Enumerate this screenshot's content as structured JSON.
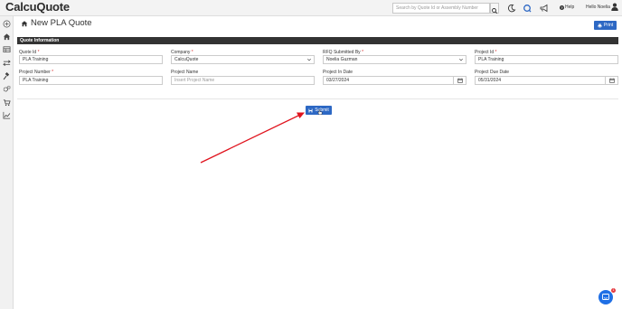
{
  "app": {
    "logo": "CalcuQuote"
  },
  "topbar": {
    "search_placeholder": "Search by Quote Id or Assembly Number",
    "help_label": "Help",
    "greeting": "Hello Noelia"
  },
  "page": {
    "title": "New PLA Quote",
    "print_label": "Print"
  },
  "section": {
    "title": "Quote Information"
  },
  "fields": {
    "quote_id": {
      "label": "Quote Id",
      "required": "*",
      "value": "PLA Training"
    },
    "company": {
      "label": "Company",
      "required": "*",
      "value": "CalcuQuote"
    },
    "rfq_submitted_by": {
      "label": "RFQ Submitted By",
      "required": "*",
      "value": "Noelia Guzman"
    },
    "project_id": {
      "label": "Project Id",
      "required": "*",
      "value": "PLA Training"
    },
    "project_number": {
      "label": "Project Number",
      "required": "*",
      "value": "PLA Training"
    },
    "project_name": {
      "label": "Project Name",
      "placeholder": "Insert Project Name"
    },
    "project_in_date": {
      "label": "Project In Date",
      "value": "03/27/2024"
    },
    "project_due_date": {
      "label": "Project Due Date",
      "value": "05/31/2024"
    }
  },
  "actions": {
    "submit_label": "Submit"
  },
  "chat": {
    "badge_count": "1"
  },
  "colors": {
    "primary": "#2d68c4",
    "section_bar": "#333333",
    "annotation_arrow": "#e0141e",
    "chat": "#1f6fe5"
  },
  "icons": {
    "sidebar": [
      "plus-circle-icon",
      "home-icon",
      "table-icon",
      "exchange-icon",
      "gavel-icon",
      "gears-icon",
      "cart-icon",
      "line-chart-icon"
    ],
    "topbar": [
      "search-icon",
      "moon-icon",
      "refresh-icon",
      "megaphone-icon",
      "question-icon",
      "user-icon"
    ]
  }
}
